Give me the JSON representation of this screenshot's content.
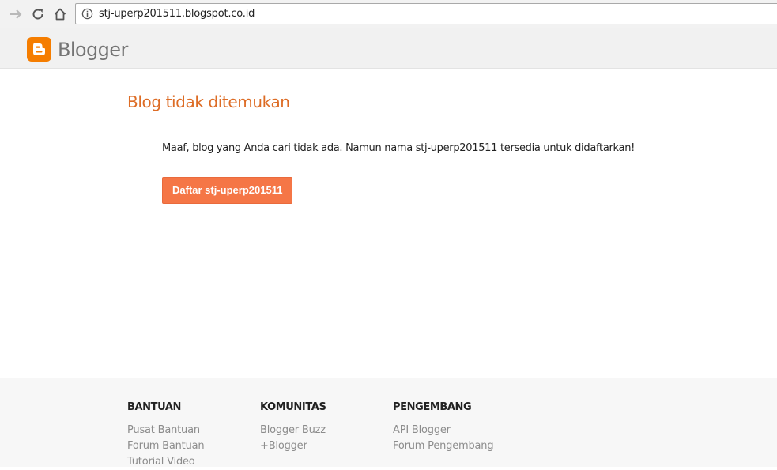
{
  "browser": {
    "url": "stj-uperp201511.blogspot.co.id",
    "icons": [
      "forward-arrow-icon",
      "reload-icon",
      "home-icon",
      "info-icon"
    ]
  },
  "header": {
    "logo_text": "Blogger",
    "logo_color": "#f57d00"
  },
  "main": {
    "title": "Blog tidak ditemukan",
    "message": "Maaf, blog yang Anda cari tidak ada. Namun nama stj-uperp201511 tersedia untuk didaftarkan!",
    "register_button": "Daftar stj-uperp201511"
  },
  "footer": {
    "columns": [
      {
        "heading": "BANTUAN",
        "links": [
          "Pusat Bantuan",
          "Forum Bantuan",
          "Tutorial Video"
        ]
      },
      {
        "heading": "KOMUNITAS",
        "links": [
          "Blogger Buzz",
          "+Blogger"
        ]
      },
      {
        "heading": "PENGEMBANG",
        "links": [
          "API Blogger",
          "Forum Pengembang"
        ]
      }
    ]
  },
  "colors": {
    "title": "#dd6c25",
    "button": "#f57646",
    "footer_bg": "#f7f7f7"
  }
}
